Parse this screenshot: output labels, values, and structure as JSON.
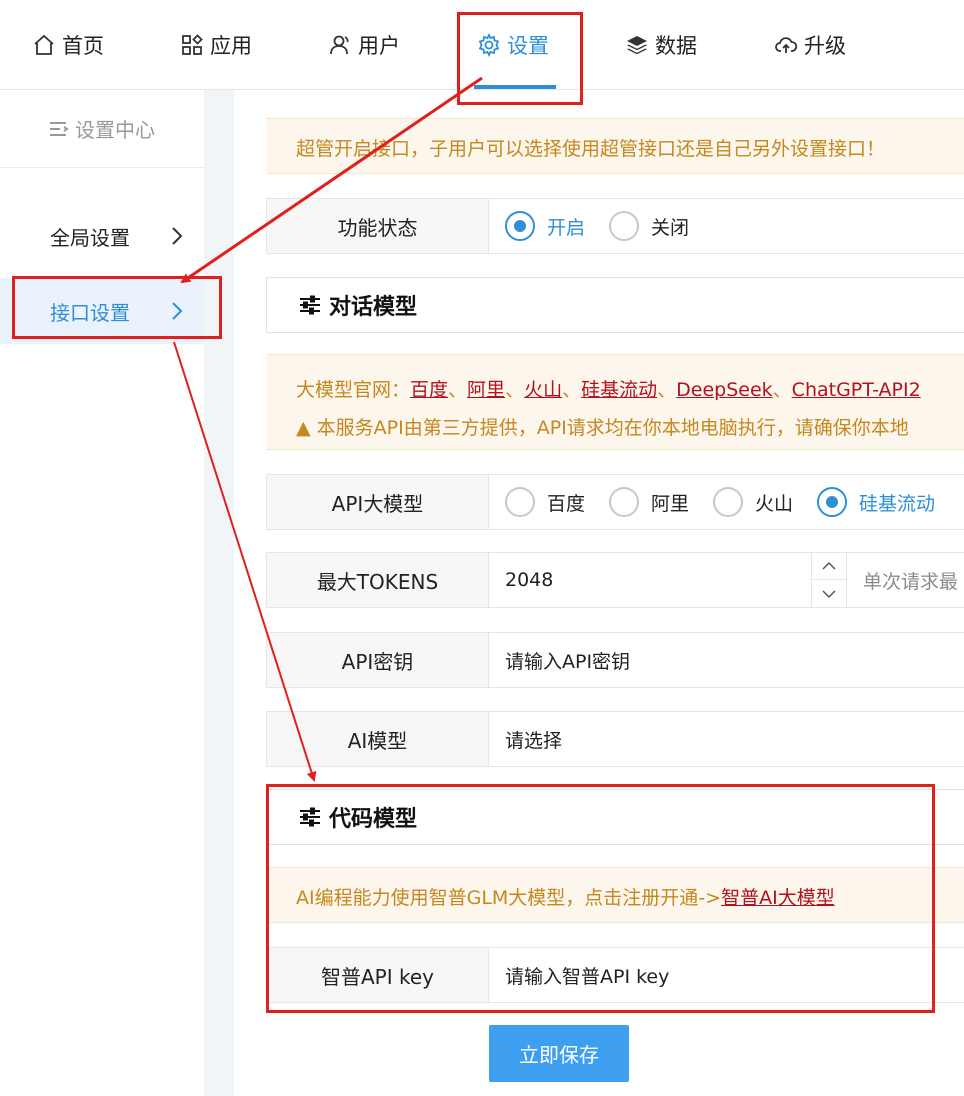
{
  "topnav": {
    "items": [
      {
        "label": "首页",
        "icon": "home-icon"
      },
      {
        "label": "应用",
        "icon": "apps-grid-icon"
      },
      {
        "label": "用户",
        "icon": "user-icon"
      },
      {
        "label": "设置",
        "icon": "gear-icon",
        "active": true
      },
      {
        "label": "数据",
        "icon": "layers-icon"
      },
      {
        "label": "升级",
        "icon": "cloud-upload-icon"
      }
    ]
  },
  "sidebar": {
    "title": "设置中心",
    "items": [
      {
        "label": "全局设置"
      },
      {
        "label": "接口设置",
        "active": true
      }
    ]
  },
  "main": {
    "notice_top": "超管开启接口，子用户可以选择使用超管接口还是自己另外设置接口！",
    "function_status": {
      "label": "功能状态",
      "options": [
        {
          "label": "开启",
          "selected": true
        },
        {
          "label": "关闭",
          "selected": false
        }
      ]
    },
    "chat_section": {
      "title": "对话模型",
      "notice_prefix": "大模型官网：",
      "links": [
        "百度",
        "阿里",
        "火山",
        "硅基流动",
        "DeepSeek",
        "ChatGPT-API2"
      ],
      "separator": "、",
      "warning": "▲ 本服务API由第三方提供，API请求均在你本地电脑执行，请确保你本地",
      "api_model": {
        "label": "API大模型",
        "options": [
          {
            "label": "百度",
            "selected": false
          },
          {
            "label": "阿里",
            "selected": false
          },
          {
            "label": "火山",
            "selected": false
          },
          {
            "label": "硅基流动",
            "selected": true
          }
        ]
      },
      "max_tokens": {
        "label": "最大TOKENS",
        "value": "2048",
        "hint": "单次请求最"
      },
      "api_key": {
        "label": "API密钥",
        "placeholder": "请输入API密钥"
      },
      "ai_model": {
        "label": "AI模型",
        "placeholder": "请选择"
      }
    },
    "code_section": {
      "title": "代码模型",
      "notice_text": "AI编程能力使用智普GLM大模型，点击注册开通->",
      "notice_link": "智普AI大模型",
      "zhipu_key": {
        "label": "智普API key",
        "placeholder": "请输入智普API key"
      }
    },
    "save_label": "立即保存"
  },
  "colors": {
    "accent": "#2e8fd8",
    "notice_text": "#c4881f",
    "notice_bg": "#fdf6ec",
    "link": "#b3111c",
    "annotation": "#e0201d",
    "button": "#3e9ff0"
  }
}
